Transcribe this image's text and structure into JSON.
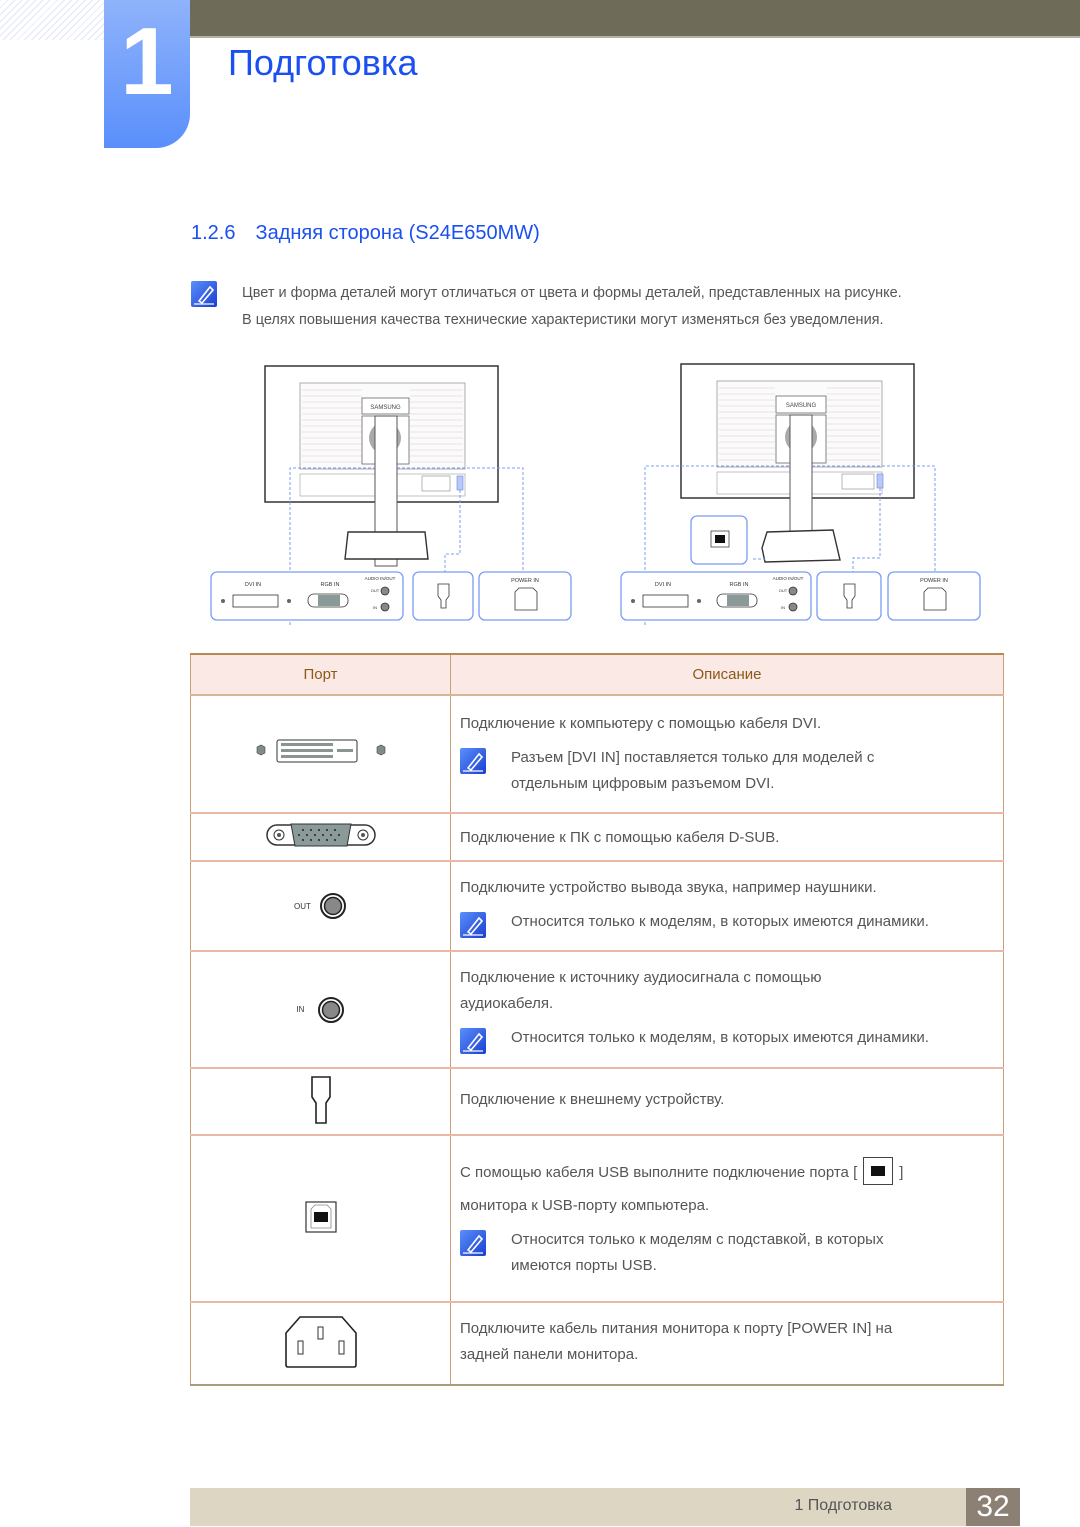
{
  "header": {
    "chapter_number": "1",
    "chapter_title": "Подготовка"
  },
  "section": {
    "number": "1.2.6",
    "title": "Задняя сторона (S24E650MW)"
  },
  "top_note": {
    "icon": "note-pencil-icon",
    "lines": [
      "Цвет и форма деталей могут отличаться от цвета и формы деталей, представленных на рисунке.",
      "В целях повышения качества технические характеристики могут изменяться без уведомления."
    ]
  },
  "diagrams": [
    {
      "variant": "without-usb-stand",
      "brand": "SAMSUNG",
      "labels": {
        "dvi": "DVI IN",
        "rgb": "RGB IN",
        "audio": "AUDIO IN/OUT",
        "out": "OUT",
        "in": "IN",
        "power": "POWER IN"
      }
    },
    {
      "variant": "with-usb-stand",
      "brand": "SAMSUNG",
      "labels": {
        "dvi": "DVI IN",
        "rgb": "RGB IN",
        "audio": "AUDIO IN/OUT",
        "out": "OUT",
        "in": "IN",
        "power": "POWER IN"
      }
    }
  ],
  "table": {
    "headers": {
      "port": "Порт",
      "description": "Описание"
    },
    "rows": [
      {
        "port_icon": "dvi-port-icon",
        "text": [
          "Подключение к компьютеру с помощью кабеля DVI."
        ],
        "note": [
          "Разъем [DVI IN] поставляется только для моделей с",
          "отдельным цифровым разъемом DVI."
        ]
      },
      {
        "port_icon": "dsub-port-icon",
        "text": [
          "Подключение к ПК с помощью кабеля D-SUB."
        ]
      },
      {
        "port_icon": "audio-out-port-icon",
        "port_label": "OUT",
        "text": [
          "Подключите устройство вывода звука, например наушники."
        ],
        "note": [
          "Относится только к моделям, в которых имеются динамики."
        ]
      },
      {
        "port_icon": "audio-in-port-icon",
        "port_label": "IN",
        "text": [
          "Подключение к источнику аудиосигнала с помощью",
          "аудиокабеля."
        ],
        "note": [
          "Относится только к моделям, в которых имеются динамики."
        ]
      },
      {
        "port_icon": "kensington-lock-icon",
        "text": [
          "Подключение к внешнему устройству."
        ]
      },
      {
        "port_icon": "usb-b-port-icon",
        "text_before_icon": "С помощью кабеля USB выполните подключение порта [",
        "text_after_icon": "]",
        "text2": "монитора к USB-порту компьютера.",
        "note": [
          "Относится только к моделям с подставкой, в которых",
          "имеются порты USB."
        ]
      },
      {
        "port_icon": "power-in-port-icon",
        "text": [
          "Подключите кабель питания монитора к порту [POWER IN] на",
          "задней панели монитора."
        ]
      }
    ]
  },
  "footer": {
    "label": "1 Подготовка",
    "page": "32"
  },
  "colors": {
    "accent_blue": "#1a4ff0",
    "header_bar": "#6e6b58",
    "table_header_bg": "#fbe9e6",
    "table_header_text": "#8a5a16",
    "footer_bg": "#dcd6c2",
    "page_box": "#8c7f73",
    "diagram_dash": "#7a9cf5"
  }
}
